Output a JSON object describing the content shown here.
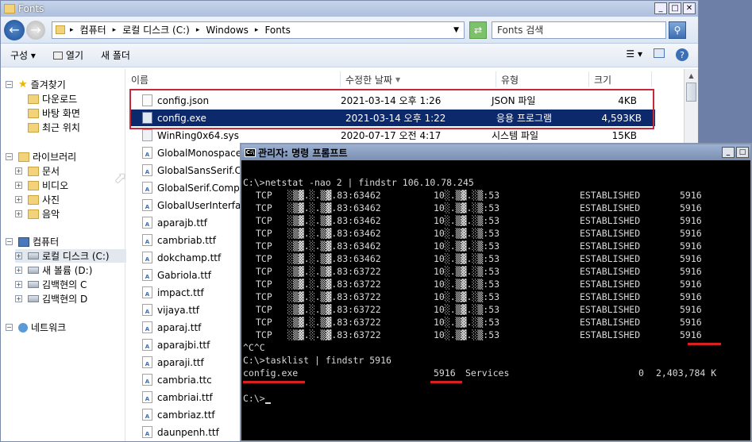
{
  "window": {
    "title": "Fonts",
    "buttons": [
      "_",
      "□",
      "✕"
    ]
  },
  "address": {
    "crumbs": [
      "컴퓨터",
      "로컬 디스크 (C:)",
      "Windows",
      "Fonts"
    ],
    "search_placeholder": "Fonts 검색"
  },
  "toolbar": {
    "organize": "구성 ▾",
    "open": "열기",
    "new_folder": "새 폴더"
  },
  "nav": {
    "items": [
      {
        "label": "즐겨찾기",
        "icon": "star-icon",
        "level": 0
      },
      {
        "label": "다운로드",
        "icon": "folder-icon",
        "level": 1
      },
      {
        "label": "바탕 화면",
        "icon": "folder-icon",
        "level": 1
      },
      {
        "label": "최근 위치",
        "icon": "folder-icon",
        "level": 1
      },
      {
        "label": "라이브러리",
        "icon": "folder-icon",
        "level": 0
      },
      {
        "label": "문서",
        "icon": "folder-icon",
        "level": 1
      },
      {
        "label": "비디오",
        "icon": "folder-icon",
        "level": 1
      },
      {
        "label": "사진",
        "icon": "folder-icon",
        "level": 1
      },
      {
        "label": "음악",
        "icon": "folder-icon",
        "level": 1
      },
      {
        "label": "컴퓨터",
        "icon": "pc-icon",
        "level": 0
      },
      {
        "label": "로컬 디스크 (C:)",
        "icon": "drive-icon",
        "level": 1
      },
      {
        "label": "새 볼륨 (D:)",
        "icon": "drive-icon",
        "level": 1
      },
      {
        "label": "김백현의 C",
        "icon": "drive-icon",
        "level": 1
      },
      {
        "label": "김백현의 D",
        "icon": "drive-icon",
        "level": 1
      },
      {
        "label": "네트워크",
        "icon": "net-icon",
        "level": 0
      }
    ]
  },
  "columns": [
    "이름",
    "수정한 날짜",
    "유형",
    "크기"
  ],
  "files": [
    {
      "name": "config.json",
      "date": "2021-03-14 오후 1:26",
      "type": "JSON 파일",
      "size": "4KB",
      "icon": "file-icon"
    },
    {
      "name": "config.exe",
      "date": "2021-03-14 오후 1:22",
      "type": "응용 프로그램",
      "size": "4,593KB",
      "icon": "exe-icon"
    },
    {
      "name": "WinRing0x64.sys",
      "date": "2020-07-17 오전 4:17",
      "type": "시스템 파일",
      "size": "15KB",
      "icon": "sys-icon"
    },
    {
      "name": "GlobalMonospace",
      "icon": "font-icon"
    },
    {
      "name": "GlobalSansSerif.C",
      "icon": "font-icon"
    },
    {
      "name": "GlobalSerif.Compo",
      "icon": "font-icon"
    },
    {
      "name": "GlobalUserInterfac",
      "icon": "font-icon"
    },
    {
      "name": "aparajb.ttf",
      "icon": "font-icon"
    },
    {
      "name": "cambriab.ttf",
      "icon": "font-icon"
    },
    {
      "name": "dokchamp.ttf",
      "icon": "font-icon"
    },
    {
      "name": "Gabriola.ttf",
      "icon": "font-icon"
    },
    {
      "name": "impact.ttf",
      "icon": "font-icon"
    },
    {
      "name": "vijaya.ttf",
      "icon": "font-icon"
    },
    {
      "name": "aparaj.ttf",
      "icon": "font-icon"
    },
    {
      "name": "aparajbi.ttf",
      "icon": "font-icon"
    },
    {
      "name": "aparaji.ttf",
      "icon": "font-icon"
    },
    {
      "name": "cambria.ttc",
      "icon": "font-icon"
    },
    {
      "name": "cambriai.ttf",
      "icon": "font-icon"
    },
    {
      "name": "cambriaz.ttf",
      "icon": "font-icon"
    },
    {
      "name": "daunpenh.ttf",
      "icon": "font-icon"
    }
  ],
  "cmd": {
    "title": "관리자: 명령 프롬프트",
    "command1": "C:\\>netstat -nao 2 | findstr 106.10.78.245",
    "rows": [
      {
        "proto": "TCP",
        "local": "░▒▓.░.▒▓.83:63462",
        "remote": "10░.▒▓.░▒:53",
        "state": "ESTABLISHED",
        "pid": "5916"
      },
      {
        "proto": "TCP",
        "local": "░▒▓.░.▒▓.83:63462",
        "remote": "10░.▒▓.░▒:53",
        "state": "ESTABLISHED",
        "pid": "5916"
      },
      {
        "proto": "TCP",
        "local": "░▒▓.░.▒▓.83:63462",
        "remote": "10░.▒▓.░▒:53",
        "state": "ESTABLISHED",
        "pid": "5916"
      },
      {
        "proto": "TCP",
        "local": "░▒▓.░.▒▓.83:63462",
        "remote": "10░.▒▓.░▒:53",
        "state": "ESTABLISHED",
        "pid": "5916"
      },
      {
        "proto": "TCP",
        "local": "░▒▓.░.▒▓.83:63462",
        "remote": "10░.▒▓.░▒:53",
        "state": "ESTABLISHED",
        "pid": "5916"
      },
      {
        "proto": "TCP",
        "local": "░▒▓.░.▒▓.83:63462",
        "remote": "10░.▒▓.░▒:53",
        "state": "ESTABLISHED",
        "pid": "5916"
      },
      {
        "proto": "TCP",
        "local": "░▒▓.░.▒▓.83:63722",
        "remote": "10░.▒▓.░▒:53",
        "state": "ESTABLISHED",
        "pid": "5916"
      },
      {
        "proto": "TCP",
        "local": "░▒▓.░.▒▓.83:63722",
        "remote": "10░.▒▓.░▒:53",
        "state": "ESTABLISHED",
        "pid": "5916"
      },
      {
        "proto": "TCP",
        "local": "░▒▓.░.▒▓.83:63722",
        "remote": "10░.▒▓.░▒:53",
        "state": "ESTABLISHED",
        "pid": "5916"
      },
      {
        "proto": "TCP",
        "local": "░▒▓.░.▒▓.83:63722",
        "remote": "10░.▒▓.░▒:53",
        "state": "ESTABLISHED",
        "pid": "5916"
      },
      {
        "proto": "TCP",
        "local": "░▒▓.░.▒▓.83:63722",
        "remote": "10░.▒▓.░▒:53",
        "state": "ESTABLISHED",
        "pid": "5916"
      },
      {
        "proto": "TCP",
        "local": "░▒▓.░.▒▓.83:63722",
        "remote": "10░.▒▓.░▒:53",
        "state": "ESTABLISHED",
        "pid": "5916"
      }
    ],
    "interrupt": "^C^C",
    "command2": "C:\\>tasklist | findstr 5916",
    "task_name": "config.exe",
    "task_pid": "5916",
    "task_session": "Services",
    "task_sessnum": "0",
    "task_mem": "2,403,784 K",
    "prompt": "C:\\>"
  },
  "colors": {
    "highlight_red": "#c8283a",
    "selection_bg": "#0c2a6b"
  }
}
